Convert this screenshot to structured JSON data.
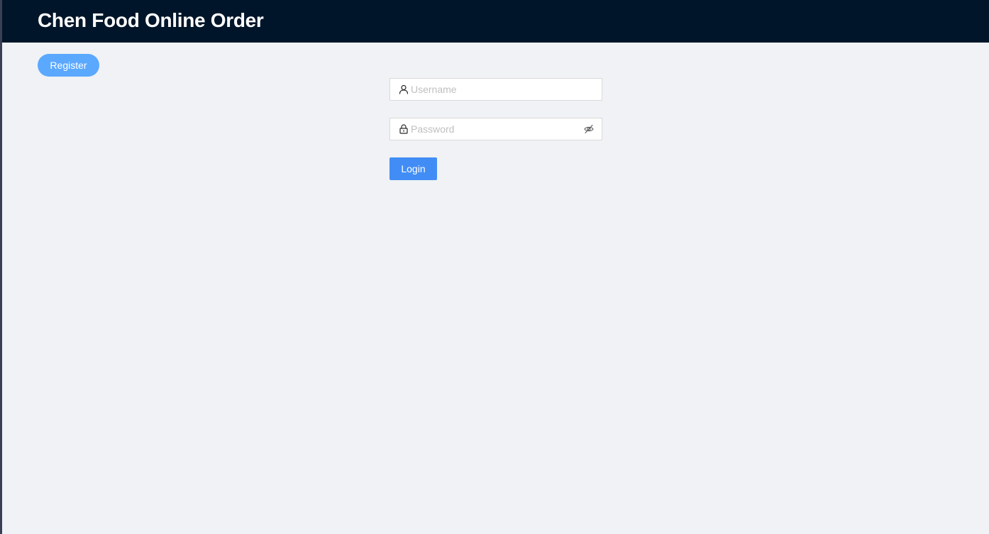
{
  "header": {
    "title": "Chen Food Online Order",
    "background": "#001529"
  },
  "register": {
    "label": "Register",
    "color": "#5ba8ff"
  },
  "login_form": {
    "username": {
      "placeholder": "Username",
      "value": "",
      "icon": "user-icon"
    },
    "password": {
      "placeholder": "Password",
      "value": "",
      "icon": "lock-icon",
      "toggle_icon": "eye-invisible-icon"
    },
    "submit_label": "Login",
    "submit_color": "#418df5"
  },
  "page": {
    "background": "#f0f2f5"
  }
}
